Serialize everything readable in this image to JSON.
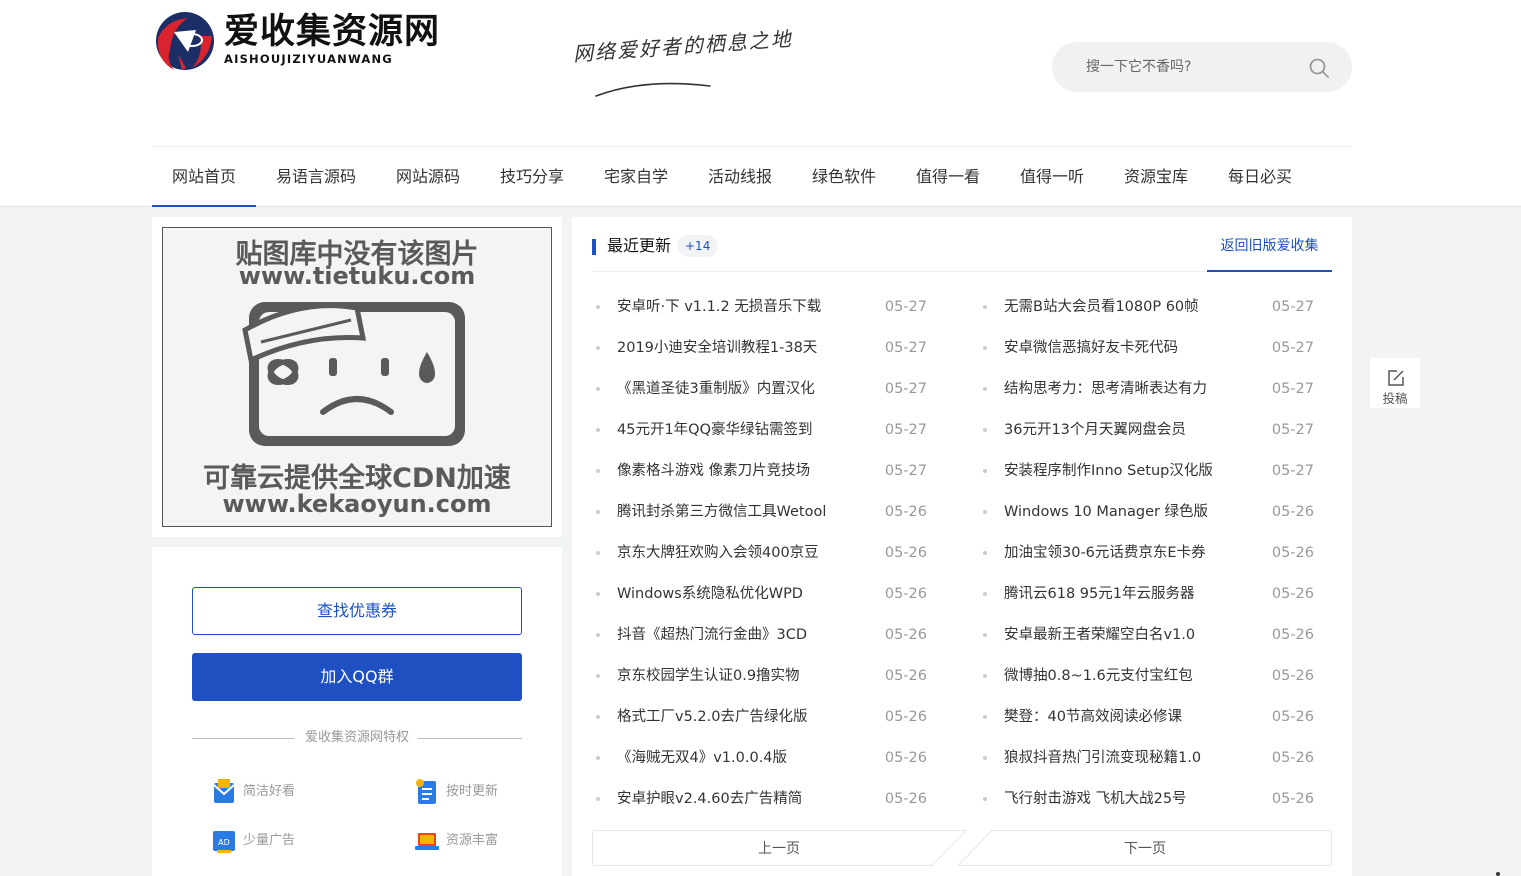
{
  "logo": {
    "title": "爱收集资源网",
    "subtitle": "AISHOUJIZIYUANWANG"
  },
  "slogan": "网络爱好者的栖息之地",
  "search": {
    "placeholder": "搜一下它不香吗?"
  },
  "nav": {
    "items": [
      {
        "label": "网站首页",
        "active": true
      },
      {
        "label": "易语言源码"
      },
      {
        "label": "网站源码"
      },
      {
        "label": "技巧分享"
      },
      {
        "label": "宅家自学"
      },
      {
        "label": "活动线报"
      },
      {
        "label": "绿色软件"
      },
      {
        "label": "值得一看"
      },
      {
        "label": "值得一听"
      },
      {
        "label": "资源宝库"
      },
      {
        "label": "每日必买"
      }
    ]
  },
  "ad": {
    "line1": "贴图库中没有该图片",
    "line2": "www.tietuku.com",
    "line3": "可靠云提供全球CDN加速",
    "line4": "www.kekaoyun.com"
  },
  "sidebar": {
    "coupon_button": "查找优惠券",
    "qq_button": "加入QQ群",
    "privilege_title": "爱收集资源网特权",
    "features": [
      {
        "label": "简洁好看",
        "icon": "envelope-icon"
      },
      {
        "label": "按时更新",
        "icon": "document-icon"
      },
      {
        "label": "少量广告",
        "icon": "ad-icon"
      },
      {
        "label": "资源丰富",
        "icon": "laptop-icon"
      }
    ]
  },
  "main": {
    "tab_title": "最近更新",
    "tab_count": "+14",
    "old_version_link": "返回旧版爱收集",
    "posts_left": [
      {
        "title": "安卓听·下 v1.1.2 无损音乐下载",
        "date": "05-27"
      },
      {
        "title": "2019小迪安全培训教程1-38天",
        "date": "05-27"
      },
      {
        "title": "《黑道圣徒3重制版》内置汉化",
        "date": "05-27"
      },
      {
        "title": "45元开1年QQ豪华绿钻需签到",
        "date": "05-27"
      },
      {
        "title": "像素格斗游戏 像素刀片竞技场",
        "date": "05-27"
      },
      {
        "title": "腾讯封杀第三方微信工具Wetool",
        "date": "05-26"
      },
      {
        "title": "京东大牌狂欢购入会领400京豆",
        "date": "05-26"
      },
      {
        "title": "Windows系统隐私优化WPD",
        "date": "05-26"
      },
      {
        "title": "抖音《超热门流行金曲》3CD",
        "date": "05-26"
      },
      {
        "title": "京东校园学生认证0.9撸实物",
        "date": "05-26"
      },
      {
        "title": "格式工厂v5.2.0去广告绿化版",
        "date": "05-26"
      },
      {
        "title": "《海贼无双4》v1.0.0.4版",
        "date": "05-26"
      },
      {
        "title": "安卓护眼v2.4.60去广告精简",
        "date": "05-26"
      }
    ],
    "posts_right": [
      {
        "title": "无需B站大会员看1080P 60帧",
        "date": "05-27"
      },
      {
        "title": "安卓微信恶搞好友卡死代码",
        "date": "05-27"
      },
      {
        "title": "结构思考力：思考清晰表达有力",
        "date": "05-27"
      },
      {
        "title": "36元开13个月天翼网盘会员",
        "date": "05-27"
      },
      {
        "title": "安装程序制作Inno Setup汉化版",
        "date": "05-27"
      },
      {
        "title": "Windows 10 Manager 绿色版",
        "date": "05-26"
      },
      {
        "title": "加油宝领30-6元话费京东E卡券",
        "date": "05-26"
      },
      {
        "title": "腾讯云618 95元1年云服务器",
        "date": "05-26"
      },
      {
        "title": "安卓最新王者荣耀空白名v1.0",
        "date": "05-26"
      },
      {
        "title": "微博抽0.8~1.6元支付宝红包",
        "date": "05-26"
      },
      {
        "title": "樊登：40节高效阅读必修课",
        "date": "05-26"
      },
      {
        "title": "狼叔抖音热门引流变现秘籍1.0",
        "date": "05-26"
      },
      {
        "title": "飞行射击游戏 飞机大战25号",
        "date": "05-26"
      }
    ],
    "pager": {
      "prev": "上一页",
      "next": "下一页"
    }
  },
  "float": {
    "submit_label": "投稿",
    "submit_icon": "edit-icon"
  },
  "colors": {
    "accent": "#1e50c2",
    "background": "#f2f3f5"
  }
}
